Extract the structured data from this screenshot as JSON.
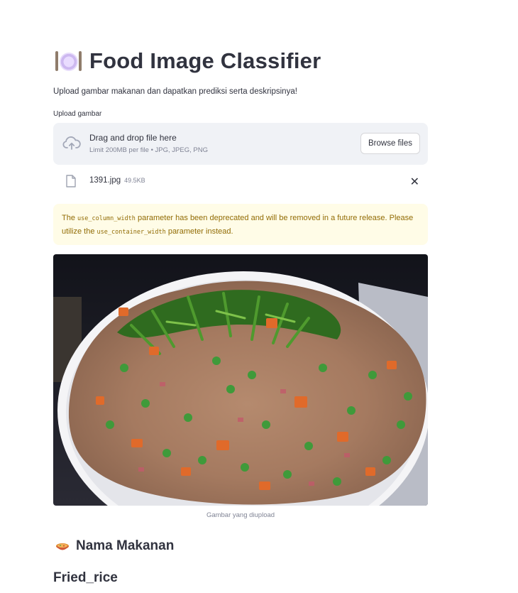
{
  "app": {
    "title": "Food Image Classifier",
    "subtitle": "Upload gambar makanan dan dapatkan prediksi serta deskripsinya!"
  },
  "uploader": {
    "label": "Upload gambar",
    "drop_text": "Drag and drop file here",
    "limit_text": "Limit 200MB per file • JPG, JPEG, PNG",
    "browse_label": "Browse files",
    "file": {
      "name": "1391.jpg",
      "size": "49.5KB"
    },
    "remove_label": "✕"
  },
  "warning": {
    "part1": "The ",
    "code1": "use_column_width",
    "part2": " parameter has been deprecated and will be removed in a future release. Please utilize the ",
    "code2": "use_container_width",
    "part3": " parameter instead."
  },
  "image": {
    "caption": "Gambar yang diupload",
    "icon": "fried-rice-photo"
  },
  "prediction": {
    "heading": "Nama Makanan",
    "heading_icon": "curry-bowl-icon",
    "value": "Fried_rice"
  },
  "colors": {
    "text": "#31333f",
    "muted": "#808495",
    "dropzone_bg": "#f0f2f6",
    "warning_bg": "#fffce7",
    "warning_text": "#926c05"
  }
}
